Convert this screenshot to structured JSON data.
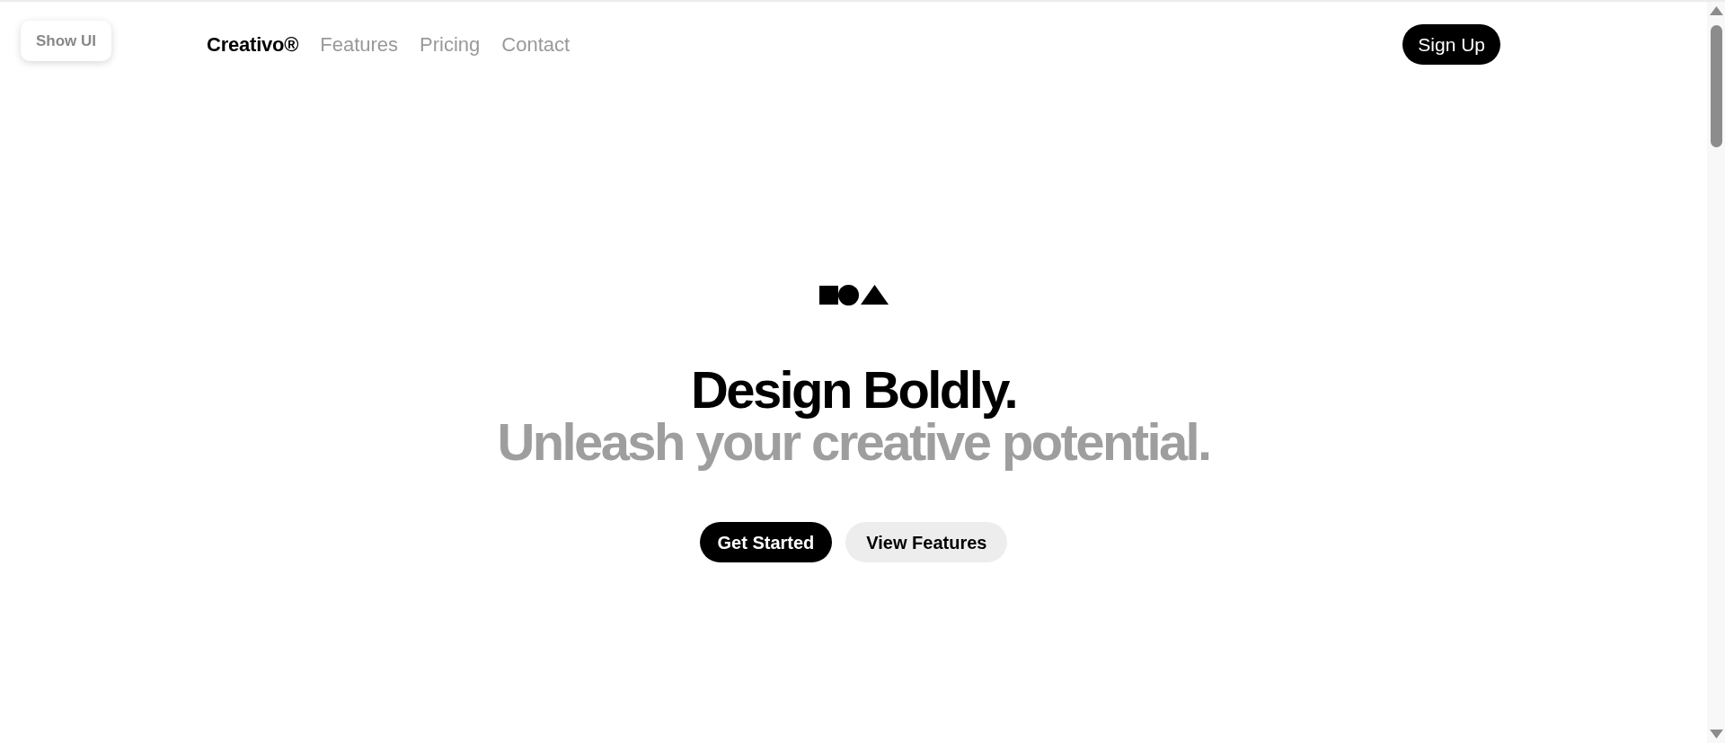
{
  "overlay_button": {
    "label": "Show UI"
  },
  "navbar": {
    "brand": "Creativo®",
    "links": [
      {
        "label": "Features"
      },
      {
        "label": "Pricing"
      },
      {
        "label": "Contact"
      }
    ],
    "cta": "Sign Up"
  },
  "hero": {
    "title": "Design Boldly.",
    "subtitle": "Unleash your creative potential.",
    "buttons": [
      {
        "label": "Get Started",
        "kind": "primary"
      },
      {
        "label": "View Features",
        "kind": "secondary"
      }
    ]
  }
}
